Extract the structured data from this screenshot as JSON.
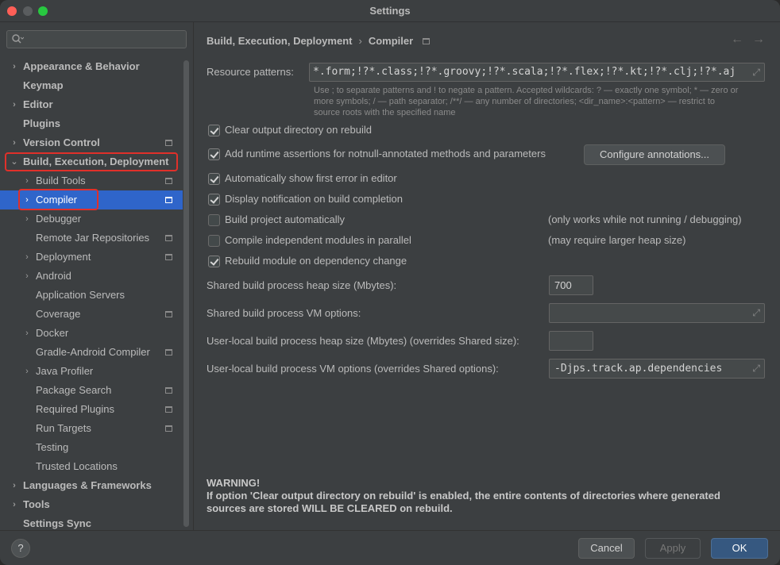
{
  "window": {
    "title": "Settings"
  },
  "search": {
    "placeholder": ""
  },
  "sidebar": {
    "items": [
      {
        "label": "Appearance & Behavior",
        "chevron": "right"
      },
      {
        "label": "Keymap"
      },
      {
        "label": "Editor",
        "chevron": "right"
      },
      {
        "label": "Plugins"
      },
      {
        "label": "Version Control",
        "chevron": "right"
      },
      {
        "label": "Build, Execution, Deployment",
        "chevron": "down"
      },
      {
        "label": "Build Tools",
        "chevron": "right"
      },
      {
        "label": "Compiler",
        "chevron": "right"
      },
      {
        "label": "Debugger",
        "chevron": "right"
      },
      {
        "label": "Remote Jar Repositories"
      },
      {
        "label": "Deployment",
        "chevron": "right"
      },
      {
        "label": "Android",
        "chevron": "right"
      },
      {
        "label": "Application Servers"
      },
      {
        "label": "Coverage"
      },
      {
        "label": "Docker",
        "chevron": "right"
      },
      {
        "label": "Gradle-Android Compiler"
      },
      {
        "label": "Java Profiler",
        "chevron": "right"
      },
      {
        "label": "Package Search"
      },
      {
        "label": "Required Plugins"
      },
      {
        "label": "Run Targets"
      },
      {
        "label": "Testing"
      },
      {
        "label": "Trusted Locations"
      },
      {
        "label": "Languages & Frameworks",
        "chevron": "right"
      },
      {
        "label": "Tools",
        "chevron": "right"
      },
      {
        "label": "Settings Sync"
      }
    ],
    "selected": "Compiler"
  },
  "breadcrumb": {
    "parent": "Build, Execution, Deployment",
    "current": "Compiler",
    "separator": "›"
  },
  "nav": {
    "back": "←",
    "forward": "→"
  },
  "resource_patterns": {
    "label": "Resource patterns:",
    "value": "*.form;!?*.class;!?*.groovy;!?*.scala;!?*.flex;!?*.kt;!?*.clj;!?*.aj",
    "hint_line1": "Use ; to separate patterns and ! to negate a pattern. Accepted wildcards: ? — exactly one symbol; * — zero or",
    "hint_line2": "more symbols; / — path separator; /**/ — any number of directories; <dir_name>:<pattern> — restrict to",
    "hint_line3": "source roots with the specified name"
  },
  "options": {
    "clear_output": {
      "label": "Clear output directory on rebuild",
      "checked": true
    },
    "runtime_assertions": {
      "label": "Add runtime assertions for notnull-annotated methods and parameters",
      "checked": true
    },
    "configure_annotations": "Configure annotations...",
    "show_first_error": {
      "label": "Automatically show first error in editor",
      "checked": true
    },
    "display_notification": {
      "label": "Display notification on build completion",
      "checked": true
    },
    "build_automatically": {
      "label": "Build project automatically",
      "checked": false,
      "note": "(only works while not running / debugging)"
    },
    "compile_parallel": {
      "label": "Compile independent modules in parallel",
      "checked": false,
      "note": "(may require larger heap size)"
    },
    "rebuild_on_dependency": {
      "label": "Rebuild module on dependency change",
      "checked": true
    }
  },
  "heap": {
    "shared_heap_label": "Shared build process heap size (Mbytes):",
    "shared_heap_value": "700",
    "shared_vm_label": "Shared build process VM options:",
    "shared_vm_value": "",
    "local_heap_label": "User-local build process heap size (Mbytes) (overrides Shared size):",
    "local_heap_value": "",
    "local_vm_label": "User-local build process VM options (overrides Shared options):",
    "local_vm_value": "-Djps.track.ap.dependencies"
  },
  "warning": {
    "title": "WARNING!",
    "line1": "If option 'Clear output directory on rebuild' is enabled, the entire contents of directories where generated",
    "line2": "sources are stored WILL BE CLEARED on rebuild."
  },
  "footer": {
    "help": "?",
    "cancel": "Cancel",
    "apply": "Apply",
    "ok": "OK"
  },
  "colors": {
    "accent": "#2f65ca",
    "ok_button": "#365880",
    "highlight_box": "#e0302a"
  }
}
